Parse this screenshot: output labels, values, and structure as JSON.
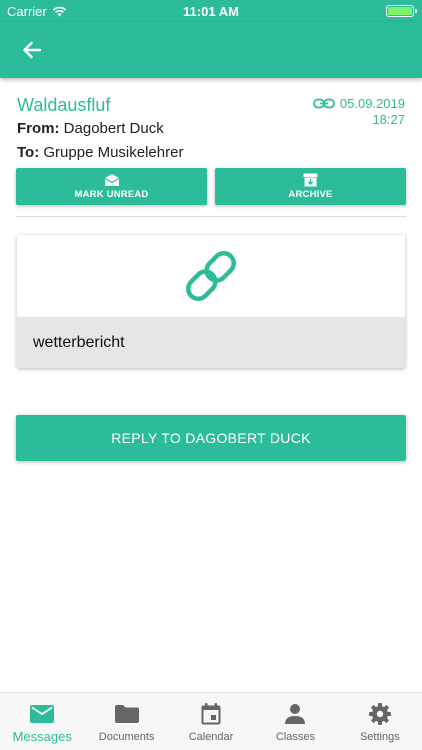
{
  "status": {
    "carrier": "Carrier",
    "time": "11:01 AM"
  },
  "message": {
    "subject": "Waldausfluf",
    "from_label": "From:",
    "from": "Dagobert Duck",
    "to_label": "To:",
    "to": "Gruppe Musikelehrer",
    "date": "05.09.2019",
    "time": "18:27"
  },
  "actions": {
    "mark_unread": "MARK UNREAD",
    "archive": "ARCHIVE"
  },
  "attachment": {
    "name": "wetterbericht",
    "icon": "link-icon"
  },
  "reply_label": "REPLY TO DAGOBERT DUCK",
  "tabs": [
    {
      "label": "Messages",
      "icon": "envelope-icon",
      "active": true
    },
    {
      "label": "Documents",
      "icon": "folder-icon",
      "active": false
    },
    {
      "label": "Calendar",
      "icon": "calendar-icon",
      "active": false
    },
    {
      "label": "Classes",
      "icon": "person-icon",
      "active": false
    },
    {
      "label": "Settings",
      "icon": "gear-icon",
      "active": false
    }
  ],
  "colors": {
    "accent": "#2cbc99",
    "inactive": "#666666",
    "attachment_bar": "#e6e6e6"
  }
}
